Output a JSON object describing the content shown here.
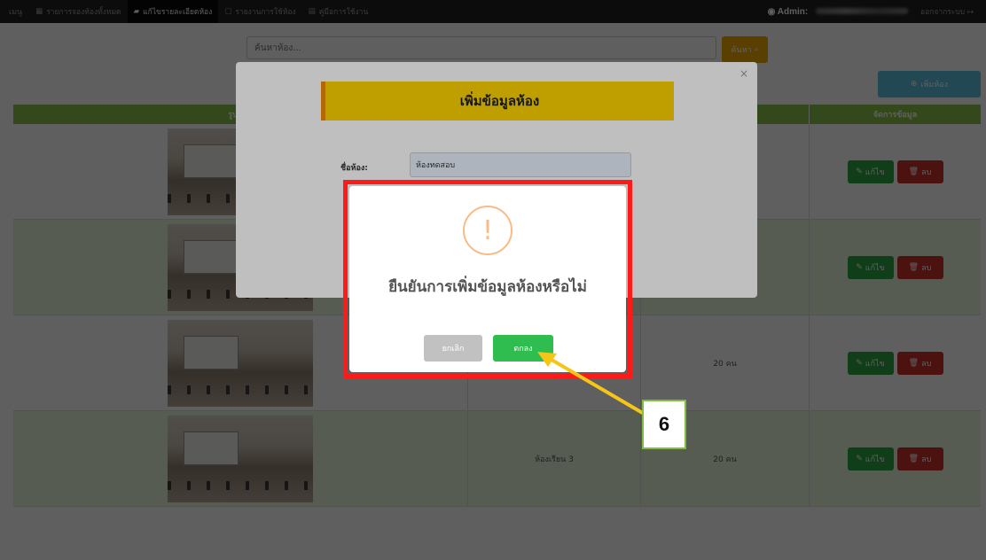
{
  "nav": {
    "brand": "เมนู",
    "items": [
      {
        "icon": "table-icon",
        "label": "รายการจองห้องทั้งหมด"
      },
      {
        "icon": "book-icon",
        "label": "แก้ไขรายละเอียดห้อง"
      },
      {
        "icon": "file-icon",
        "label": "รายงานการใช้ห้อง"
      },
      {
        "icon": "document-icon",
        "label": "คู่มือการใช้งาน"
      }
    ],
    "admin_label": "Admin:",
    "logout_label": "ออกจากระบบ"
  },
  "search": {
    "placeholder": "ค้นหาห้อง...",
    "button_label": "ค้นหา"
  },
  "add_room_button": "เพิ่มห้อง",
  "table": {
    "headers": [
      "รูปภาพ",
      "",
      "",
      "จัดการข้อมูล"
    ],
    "rows": [
      {
        "name": "",
        "capacity": ""
      },
      {
        "name": "",
        "capacity": ""
      },
      {
        "name": "",
        "capacity": "20 คน"
      },
      {
        "name": "ห้องเรียน 3",
        "capacity": "20 คน"
      }
    ],
    "edit_label": "แก้ไข",
    "delete_label": "ลบ"
  },
  "modal": {
    "close": "×",
    "title": "เพิ่มข้อมูลห้อง",
    "room_name_label": "ชื่อห้อง:",
    "room_name_value": "ห้องทดสอบ"
  },
  "alert": {
    "icon": "!",
    "title": "ยืนยันการเพิ่มข้อมูลห้องหรือไม่",
    "cancel_label": "ยกเลิก",
    "ok_label": "ตกลง"
  },
  "annotation": {
    "step": "6",
    "highlight_color": "#ff1a1a",
    "arrow_color": "#f5c518"
  }
}
